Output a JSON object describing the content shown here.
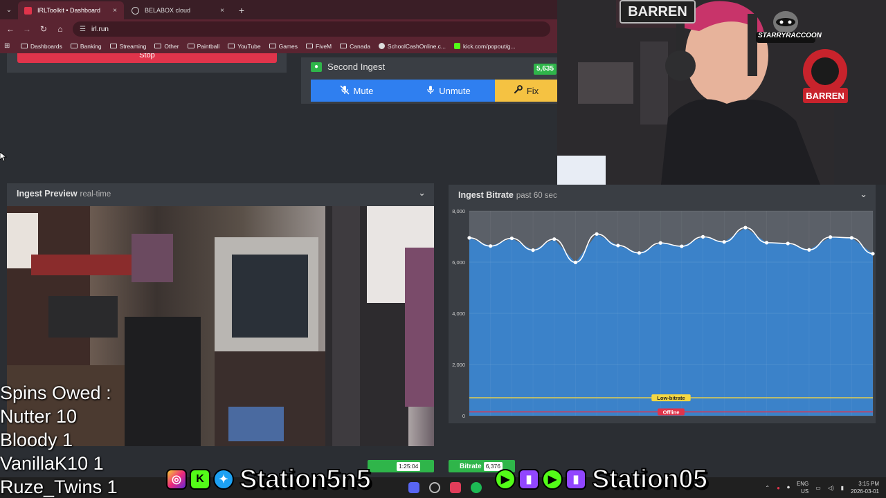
{
  "browser": {
    "tabs": [
      {
        "label": "IRLToolkit • Dashboard",
        "close": "×"
      },
      {
        "label": "BELABOX cloud",
        "close": "×"
      }
    ],
    "new_tab": "+",
    "url": "irl.run",
    "bookmarks": [
      {
        "label": "Dashboards",
        "icon": "folder-icon"
      },
      {
        "label": "Banking",
        "icon": "folder-icon"
      },
      {
        "label": "Streaming",
        "icon": "folder-icon"
      },
      {
        "label": "Other",
        "icon": "folder-icon"
      },
      {
        "label": "Paintball",
        "icon": "folder-icon"
      },
      {
        "label": "YouTube",
        "icon": "folder-icon"
      },
      {
        "label": "Games",
        "icon": "folder-icon"
      },
      {
        "label": "FiveM",
        "icon": "folder-icon"
      },
      {
        "label": "Canada",
        "icon": "folder-icon"
      },
      {
        "label": "SchoolCashOnline.c...",
        "icon": "site-icon"
      },
      {
        "label": "kick.com/popout/g...",
        "icon": "kick-icon"
      }
    ]
  },
  "dashboard": {
    "stop_label": "Stop",
    "second_ingest": {
      "title": "Second Ingest",
      "bitrate": "5,635",
      "mute": "Mute",
      "unmute": "Unmute",
      "fix": "Fix"
    },
    "preview": {
      "title": "Ingest Preview",
      "subtitle": "real-time"
    },
    "bitrate_panel": {
      "title": "Ingest Bitrate",
      "subtitle": "past 60 sec"
    }
  },
  "chart_data": {
    "type": "area",
    "ylim": [
      0,
      8000
    ],
    "yticks": [
      "8,000",
      "6,000",
      "4,000",
      "2,000",
      "0"
    ],
    "ytick_values": [
      8000,
      6000,
      4000,
      2000,
      0
    ],
    "grid": true,
    "values": [
      6950,
      6630,
      6930,
      6470,
      6900,
      5990,
      7100,
      6650,
      6360,
      6750,
      6620,
      6990,
      6790,
      7350,
      6760,
      6730,
      6480,
      6980,
      6950,
      6330
    ],
    "threshold_lines": [
      {
        "label": "Low-bitrate",
        "value": 700,
        "color": "#f5d742"
      },
      {
        "label": "Offline",
        "value": 150,
        "color": "#e0344b"
      }
    ],
    "colors": {
      "fill": "#3b82c9",
      "line": "#ffffff"
    }
  },
  "overlay": {
    "spins_title": "Spins Owed :",
    "spins": [
      "Nutter 10",
      "Bloody 1",
      "VanillaK10 1",
      "Ruze_Twins 1"
    ],
    "status": {
      "uptime_value": "1:25:04",
      "bitrate_label": "Bitrate",
      "bitrate_value": "6,376"
    },
    "socials_left": "Station5n5",
    "socials_right": "Station05"
  },
  "webcam": {
    "logo_text": "STARRYRACCOON",
    "banner_text": "BARREN"
  },
  "taskbar": {
    "lang_top": "ENG",
    "lang_bottom": "US",
    "time": "3:15 PM",
    "date": "2026-03-01"
  }
}
